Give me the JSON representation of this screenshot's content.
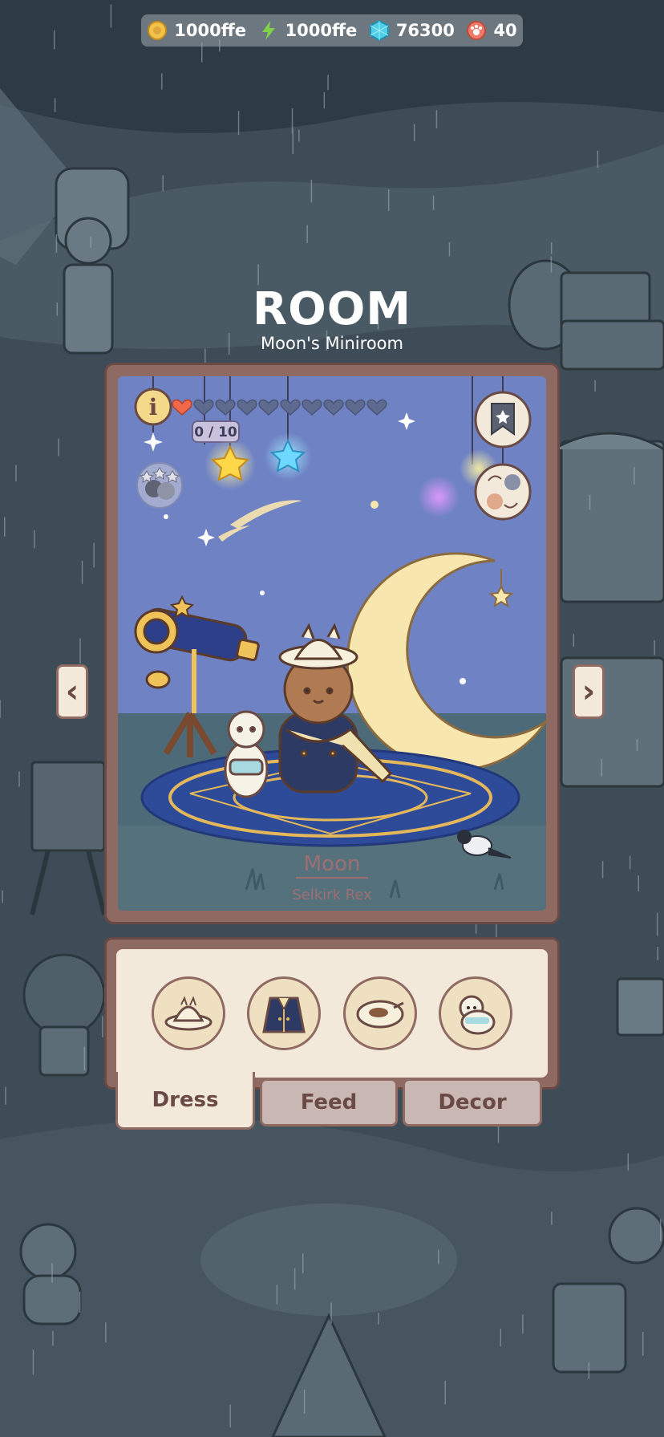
{
  "currencies": [
    {
      "icon": "coin-icon",
      "value": "1000ffe",
      "color": "#f2c24a"
    },
    {
      "icon": "lightning-icon",
      "value": "1000ffe",
      "color": "#7fd34a"
    },
    {
      "icon": "gem-icon",
      "value": "76300",
      "color": "#4fd0e8"
    },
    {
      "icon": "paw-token-icon",
      "value": "40",
      "color": "#f07a6a"
    }
  ],
  "room": {
    "title": "ROOM",
    "subtitle": "Moon's Miniroom",
    "hearts_filled": 1,
    "hearts_total": 10,
    "heart_counter": "0 / 10",
    "cat_name": "Moon",
    "cat_breed": "Selkirk Rex"
  },
  "tray": {
    "items": [
      {
        "icon": "hat-icon"
      },
      {
        "icon": "jacket-icon"
      },
      {
        "icon": "food-bowl-icon"
      },
      {
        "icon": "alpaca-plush-icon"
      }
    ]
  },
  "tabs": [
    {
      "label": "Dress",
      "active": true
    },
    {
      "label": "Feed",
      "active": false
    },
    {
      "label": "Decor",
      "active": false
    }
  ],
  "colors": {
    "frame": "#8f6a62",
    "panel": "#f2e9da",
    "scene_sky": "#6f82c4",
    "moon": "#f7e6ae"
  }
}
